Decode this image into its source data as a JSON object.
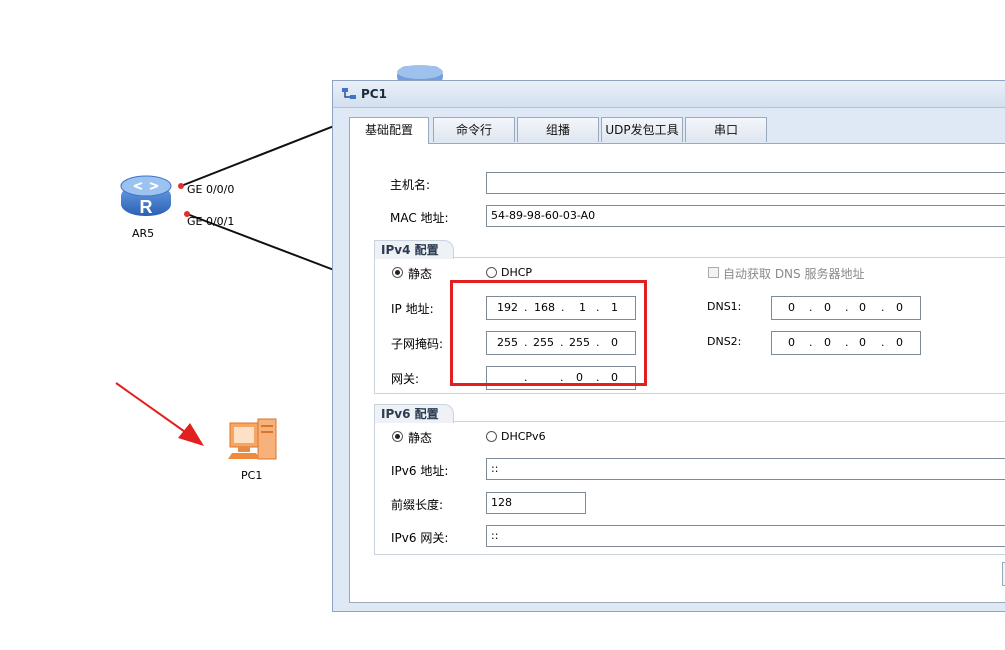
{
  "topology": {
    "router_label": "AR5",
    "port1": "GE 0/0/0",
    "port2": "GE 0/0/1",
    "pc_label": "PC1"
  },
  "dialog": {
    "title": "PC1",
    "tabs": [
      {
        "label": "基础配置",
        "active": true
      },
      {
        "label": "命令行",
        "active": false
      },
      {
        "label": "组播",
        "active": false
      },
      {
        "label": "UDP发包工具",
        "active": false
      },
      {
        "label": "串口",
        "active": false
      }
    ],
    "hostname": {
      "label": "主机名:",
      "value": ""
    },
    "mac": {
      "label": "MAC 地址:",
      "value": "54-89-98-60-03-A0"
    },
    "ipv4": {
      "group_title": "IPv4 配置",
      "static_label": "静态",
      "dhcp_label": "DHCP",
      "mode": "static",
      "auto_dns_label": "自动获取 DNS 服务器地址",
      "ip_label": "IP 地址:",
      "ip": [
        "192",
        "168",
        "1",
        "1"
      ],
      "mask_label": "子网掩码:",
      "mask": [
        "255",
        "255",
        "255",
        "0"
      ],
      "gateway_label": "网关:",
      "gateway": [
        "",
        "",
        "0",
        "0"
      ],
      "dns1_label": "DNS1:",
      "dns1": [
        "0",
        "0",
        "0",
        "0"
      ],
      "dns2_label": "DNS2:",
      "dns2": [
        "0",
        "0",
        "0",
        "0"
      ]
    },
    "ipv6": {
      "group_title": "IPv6 配置",
      "static_label": "静态",
      "dhcp_label": "DHCPv6",
      "mode": "static",
      "addr_label": "IPv6 地址:",
      "addr": "::",
      "prefix_label": "前缀长度:",
      "prefix": "128",
      "gateway_label": "IPv6 网关:",
      "gateway": "::"
    }
  },
  "colors": {
    "highlight": "#e32020",
    "arrow": "#e32020",
    "router": "#3d74c9",
    "pc": "#f08a3c"
  }
}
